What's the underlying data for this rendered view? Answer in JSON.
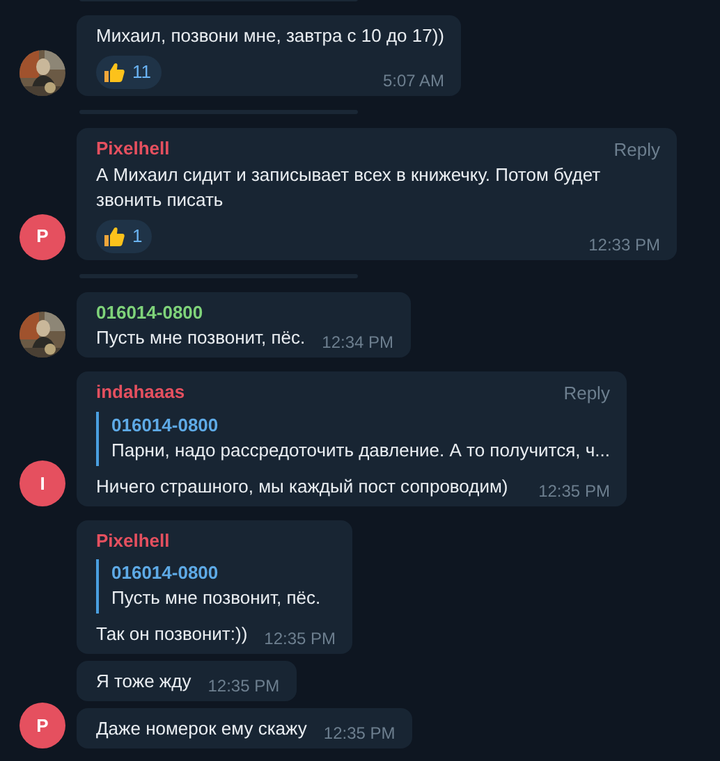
{
  "feed": [
    {
      "kind": "divider"
    },
    {
      "kind": "group",
      "messages": [
        {
          "text": "Михаил, позвони мне, завтра с 10 до 17))",
          "reaction": {
            "count": "11"
          },
          "time": "5:07 AM"
        }
      ]
    },
    {
      "kind": "divider"
    },
    {
      "kind": "group",
      "avatar": {
        "kind": "letter",
        "letter": "P",
        "color": "#e5505f"
      },
      "messages": [
        {
          "sender": "Pixelhell",
          "color": "#e5505f",
          "reply_link": "Reply",
          "text": "А Михаил сидит и записывает всех в книжечку. Потом будет звонить писать",
          "reaction": {
            "count": "1"
          },
          "time": "12:33 PM"
        }
      ]
    },
    {
      "kind": "divider"
    },
    {
      "kind": "group",
      "messages": [
        {
          "sender": "016014-0800",
          "color": "#7fd37a",
          "text": "Пусть мне позвонит, пёс.",
          "time": "12:34 PM"
        }
      ]
    },
    {
      "kind": "group",
      "avatar": {
        "kind": "letter",
        "letter": "I",
        "color": "#e5505f"
      },
      "messages": [
        {
          "sender": "indahaaas",
          "color": "#e5505f",
          "reply_link": "Reply",
          "quote": {
            "author": "016014-0800",
            "text": "Парни, надо рассредоточить давление. А то получится, ч..."
          },
          "text": "Ничего страшного, мы каждый пост сопроводим)",
          "time": "12:35 PM"
        }
      ]
    },
    {
      "kind": "group",
      "avatar": {
        "kind": "letter",
        "letter": "P",
        "color": "#e5505f"
      },
      "messages": [
        {
          "sender": "Pixelhell",
          "color": "#e5505f",
          "quote": {
            "author": "016014-0800",
            "text": "Пусть мне позвонит, пёс."
          },
          "text": "Так он позвонит:))",
          "time": "12:35 PM"
        },
        {
          "text": "Я тоже жду",
          "time": "12:35 PM"
        },
        {
          "text": "Даже номерок ему скажу",
          "time": "12:35 PM"
        }
      ]
    }
  ]
}
